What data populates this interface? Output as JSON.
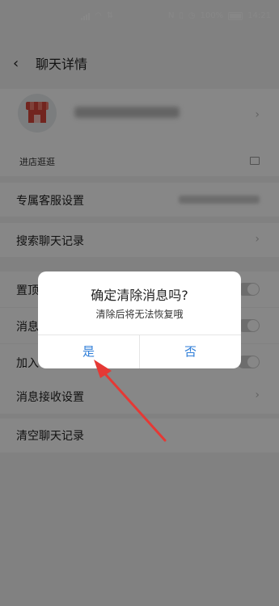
{
  "status_bar": {
    "battery_text": "100%",
    "time": "14:21"
  },
  "header": {
    "title": "聊天详情",
    "back_icon": "chevron-left-icon"
  },
  "shop": {
    "name_blurred": true
  },
  "rows": {
    "visit_store": "进店逛逛",
    "exclusive_service": "专属客服设置",
    "search_chat": "搜索聊天记录",
    "pin_partial": "置顶",
    "msg_partial": "消息",
    "join_partial": "加入",
    "msg_receive": "消息接收设置",
    "clear_chat": "清空聊天记录"
  },
  "dialog": {
    "title": "确定清除消息吗?",
    "message": "清除后将无法恢复哦",
    "yes_label": "是",
    "no_label": "否"
  },
  "colors": {
    "accent": "#2f7ed8",
    "arrow": "#e53935"
  }
}
